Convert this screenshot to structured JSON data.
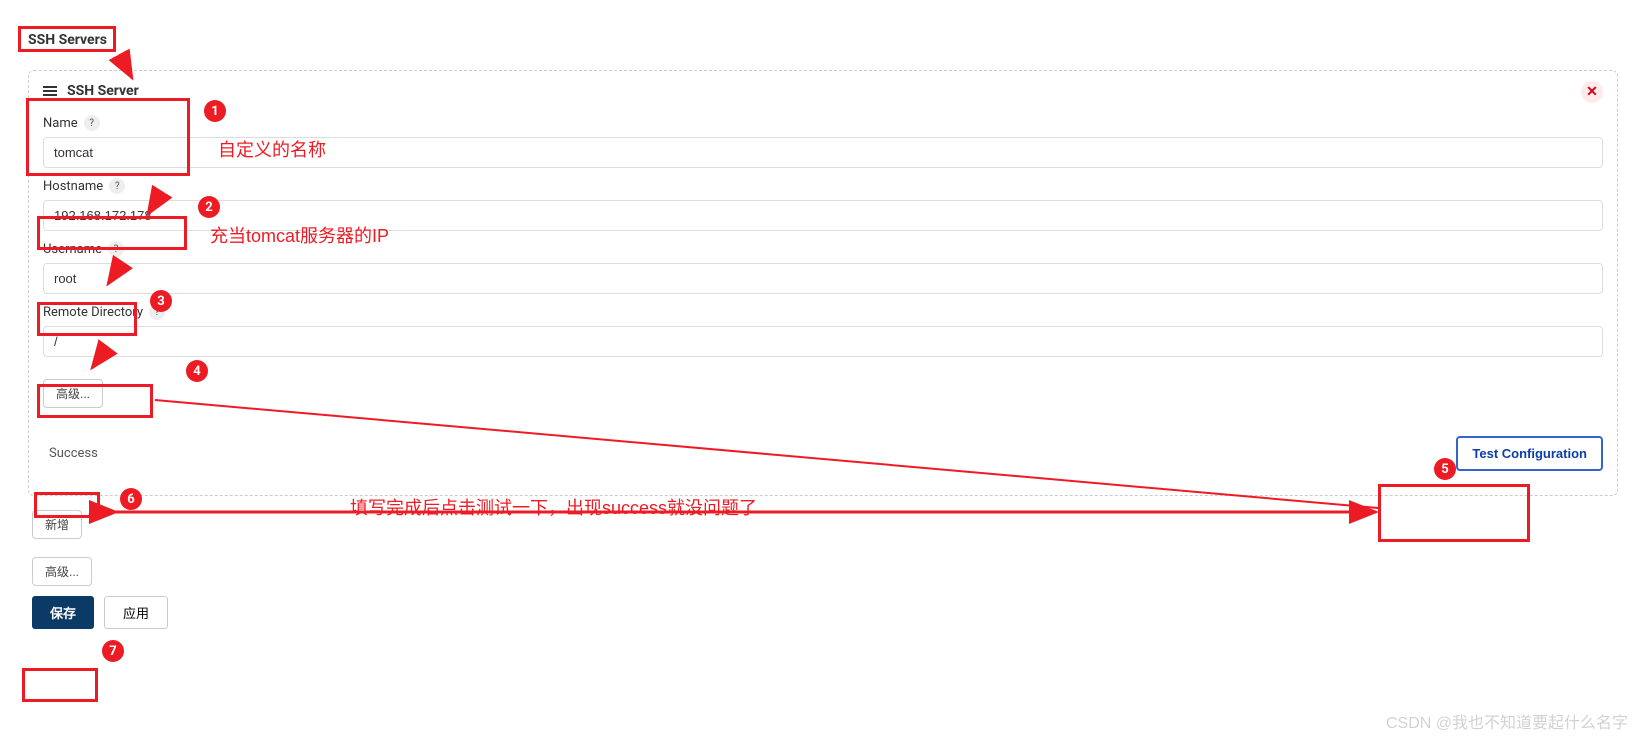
{
  "section_title": "SSH Servers",
  "panel_title": "SSH Server",
  "fields": {
    "name_label": "Name",
    "name_value": "tomcat",
    "hostname_label": "Hostname",
    "hostname_value": "192.168.172.178",
    "username_label": "Username",
    "username_value": "root",
    "remotedir_label": "Remote Directory",
    "remotedir_value": "/"
  },
  "buttons": {
    "advanced": "高级...",
    "add_new": "新增",
    "advanced2": "高级...",
    "save": "保存",
    "apply": "应用",
    "test": "Test Configuration"
  },
  "status": "Success",
  "help_glyph": "?",
  "annotations": {
    "a1": "自定义的名称",
    "a2": "充当tomcat服务器的IP",
    "a3": "填写完成后点击测试一下，出现success就没问题了",
    "n1": "1",
    "n2": "2",
    "n3": "3",
    "n4": "4",
    "n5": "5",
    "n6": "6",
    "n7": "7"
  },
  "watermark": "CSDN @我也不知道要起什么名字"
}
